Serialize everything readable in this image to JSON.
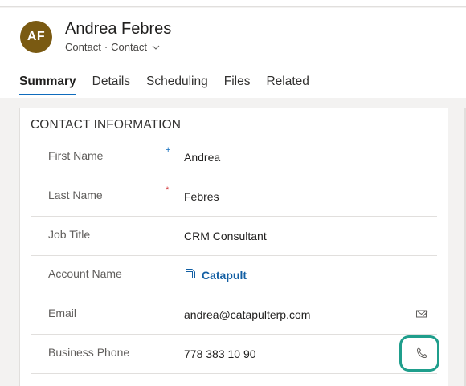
{
  "record": {
    "initials": "AF",
    "name": "Andrea Febres",
    "entity": "Contact",
    "form": "Contact",
    "avatar_color": "#7a5a12"
  },
  "tabs": [
    {
      "label": "Summary",
      "active": true
    },
    {
      "label": "Details",
      "active": false
    },
    {
      "label": "Scheduling",
      "active": false
    },
    {
      "label": "Files",
      "active": false
    },
    {
      "label": "Related",
      "active": false
    }
  ],
  "section": {
    "title": "CONTACT INFORMATION",
    "fields": {
      "first_name": {
        "label": "First Name",
        "value": "Andrea",
        "requirement": "recommended"
      },
      "last_name": {
        "label": "Last Name",
        "value": "Febres",
        "requirement": "required"
      },
      "job_title": {
        "label": "Job Title",
        "value": "CRM Consultant"
      },
      "account_name": {
        "label": "Account Name",
        "value": "Catapult"
      },
      "email": {
        "label": "Email",
        "value": "andrea@catapulterp.com"
      },
      "business_phone": {
        "label": "Business Phone",
        "value": "778 383 10 90"
      }
    }
  },
  "markers": {
    "recommended": "+",
    "required": "*"
  },
  "colors": {
    "accent": "#0f6cbd",
    "link": "#115ea3",
    "required": "#d13438",
    "highlight": "#1f9e8c"
  }
}
